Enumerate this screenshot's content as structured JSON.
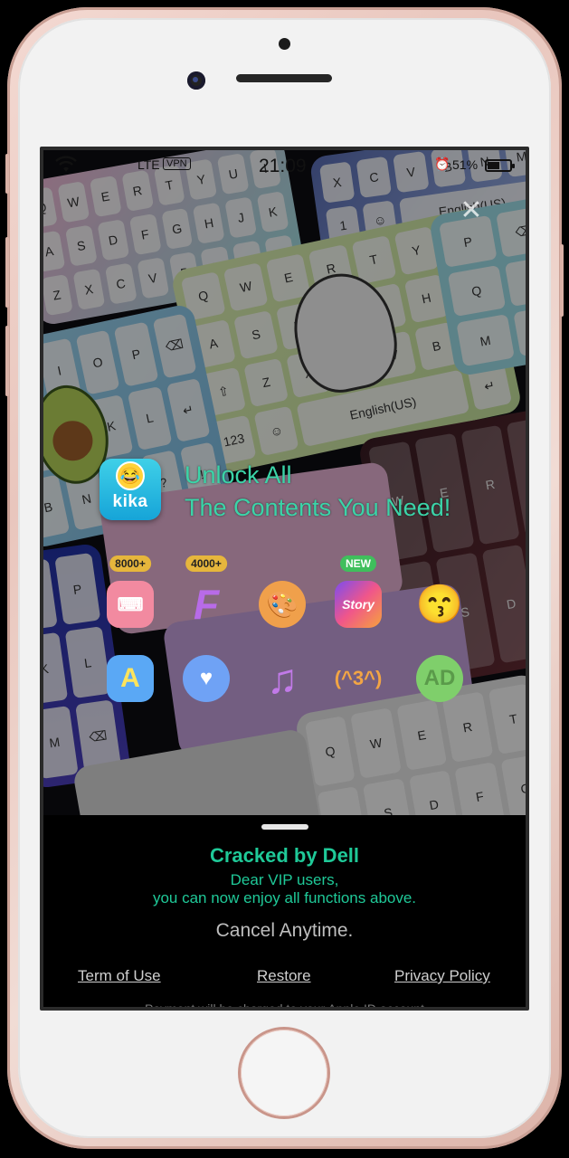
{
  "status_bar": {
    "network": "LTE",
    "vpn": "VPN",
    "time": "21:09",
    "battery": "51%"
  },
  "headline": {
    "line1": "Unlock All",
    "line2": "The Contents You Need!"
  },
  "logo": {
    "word": "kika"
  },
  "features": {
    "row1": [
      {
        "icon": "keyboard-theme-icon",
        "badge": "8000+"
      },
      {
        "icon": "font-icon",
        "badge": "4000+"
      },
      {
        "icon": "palette-icon",
        "badge": ""
      },
      {
        "icon": "story-icon",
        "badge": "NEW"
      },
      {
        "icon": "kiss-emoji-icon",
        "badge": ""
      }
    ],
    "row2": [
      {
        "icon": "translate-icon"
      },
      {
        "icon": "chat-bubble-icon"
      },
      {
        "icon": "music-note-icon"
      },
      {
        "icon": "kaomoji-icon"
      },
      {
        "icon": "no-ads-icon"
      }
    ]
  },
  "sheet": {
    "title": "Cracked by Dell",
    "line1": "Dear VIP users,",
    "line2": "you can now enjoy all functions above.",
    "cancel": "Cancel Anytime.",
    "term": "Term of Use",
    "restore": "Restore",
    "privacy": "Privacy Policy",
    "fineprint": "Payment will be charged to your Apple ID account"
  },
  "misc": {
    "story_text": "Story",
    "kaomoji_text": "(^3^)",
    "ad_text": "AD",
    "font_letter": "F",
    "translate_letter": "A"
  }
}
